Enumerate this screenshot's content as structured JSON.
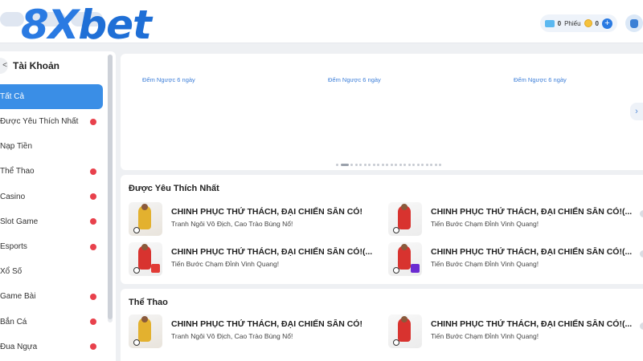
{
  "header": {
    "logo_text_prefix": "8X",
    "logo_text_suffix": "bet",
    "tickets_value": "0",
    "tickets_label": "Phiếu",
    "coins_value": "0",
    "plus_label": "+"
  },
  "sidebar": {
    "back_label": "<",
    "title": "Tài Khoản",
    "items": [
      {
        "label": "Tất Cả",
        "active": true,
        "badge": false
      },
      {
        "label": "Được Yêu Thích Nhất",
        "active": false,
        "badge": true
      },
      {
        "label": "Nạp Tiền",
        "active": false,
        "badge": false
      },
      {
        "label": "Thể Thao",
        "active": false,
        "badge": true
      },
      {
        "label": "Casino",
        "active": false,
        "badge": true
      },
      {
        "label": "Slot Game",
        "active": false,
        "badge": true
      },
      {
        "label": "Esports",
        "active": false,
        "badge": true
      },
      {
        "label": "Xổ Số",
        "active": false,
        "badge": false
      },
      {
        "label": "Game Bài",
        "active": false,
        "badge": true
      },
      {
        "label": "Bắn Cá",
        "active": false,
        "badge": true
      },
      {
        "label": "Đua Ngựa",
        "active": false,
        "badge": true
      }
    ]
  },
  "banner": {
    "countdowns": [
      "Đếm Ngược 6 ngày",
      "Đếm Ngược 6 ngày",
      "Đếm Ngược 6 ngày"
    ],
    "next_label": "›",
    "page_count": 23,
    "active_page": 1
  },
  "sections": [
    {
      "title": "Được Yêu Thích Nhất",
      "cards": [
        {
          "title": "CHINH PHỤC THỬ THÁCH, ĐẠI CHIẾN SÂN CỎ!",
          "subtitle": "Tranh Ngôi Vô Địch, Cao Trào Bùng Nổ!"
        },
        {
          "title": "CHINH PHỤC THỬ THÁCH, ĐẠI CHIẾN SÂN CỎ!(...",
          "subtitle": "Tiến Bước Chạm Đỉnh Vinh Quang!"
        },
        {
          "title": "CHINH PHỤC THỬ THÁCH, ĐẠI CHIẾN SÂN CỎ!(...",
          "subtitle": "Tiến Bước Chạm Đỉnh Vinh Quang!"
        },
        {
          "title": "CHINH PHỤC THỬ THÁCH, ĐẠI CHIẾN SÂN CỎ!(...",
          "subtitle": "Tiến Bước Chạm Đỉnh Vinh Quang!"
        }
      ]
    },
    {
      "title": "Thể Thao",
      "cards": [
        {
          "title": "CHINH PHỤC THỬ THÁCH, ĐẠI CHIẾN SÂN CỎ!",
          "subtitle": "Tranh Ngôi Vô Địch, Cao Trào Bùng Nổ!"
        },
        {
          "title": "CHINH PHỤC THỬ THÁCH, ĐẠI CHIẾN SÂN CỎ!(...",
          "subtitle": "Tiến Bước Chạm Đỉnh Vinh Quang!"
        }
      ]
    }
  ],
  "colors": {
    "accent": "#3a8ee6",
    "badge": "#e8414c",
    "countdown": "#3c7ed8"
  },
  "icons": [
    "ticket-icon",
    "coin-icon",
    "plus-icon",
    "bag-icon",
    "back-icon",
    "chevron-right-icon"
  ]
}
